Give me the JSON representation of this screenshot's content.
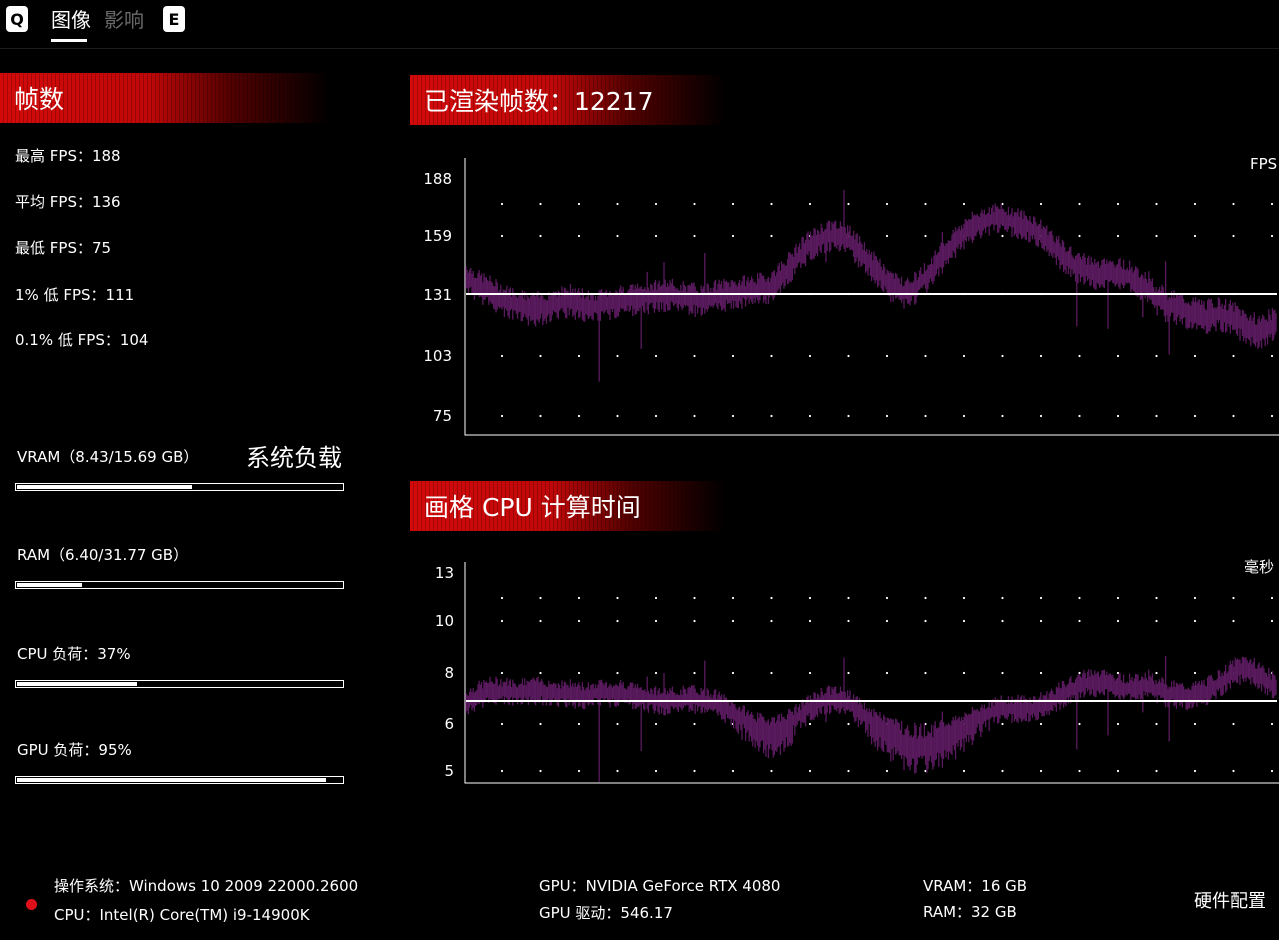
{
  "tabs": {
    "left_key": "Q",
    "right_key": "E",
    "items": [
      {
        "label": "图像",
        "active": true
      },
      {
        "label": "影响",
        "active": false
      }
    ]
  },
  "frames": {
    "title": "帧数",
    "stats": [
      {
        "label": "最高 FPS：",
        "value": "188"
      },
      {
        "label": "平均 FPS：",
        "value": "136"
      },
      {
        "label": "最低 FPS：",
        "value": "75"
      },
      {
        "label": "1% 低 FPS：",
        "value": "111"
      },
      {
        "label": "0.1% 低 FPS：",
        "value": "104"
      }
    ]
  },
  "system_load": {
    "title": "系统负载",
    "meters": [
      {
        "label": "VRAM（8.43/15.69 GB）",
        "fraction": 0.537
      },
      {
        "label": "RAM（6.40/31.77 GB）",
        "fraction": 0.201
      },
      {
        "label": "CPU 负荷：37%",
        "fraction": 0.37
      },
      {
        "label": "GPU 负荷：95%",
        "fraction": 0.95
      }
    ]
  },
  "fps_chart": {
    "title": "已渲染帧数：12217",
    "unit": "FPS",
    "y_ticks": [
      "188",
      "159",
      "131",
      "103",
      "75"
    ]
  },
  "cpu_chart": {
    "title": "画格 CPU 计算时间",
    "unit": "毫秒",
    "y_ticks": [
      "13",
      "10",
      "8",
      "6",
      "5"
    ]
  },
  "chart_data": [
    {
      "type": "area",
      "title": "已渲染帧数：12217",
      "ylabel": "FPS",
      "ylim": [
        75,
        188
      ],
      "y_ticks": [
        188,
        159,
        131,
        103,
        75
      ],
      "average_line": 131,
      "series": [
        {
          "color": "#5a1a5e",
          "values": [
            140,
            135,
            132,
            128,
            126,
            124,
            125,
            127,
            128,
            126,
            125,
            127,
            128,
            129,
            130,
            131,
            130,
            129,
            128,
            130,
            131,
            132,
            133,
            134,
            140,
            147,
            154,
            158,
            160,
            157,
            150,
            143,
            136,
            132,
            134,
            140,
            148,
            156,
            162,
            166,
            168,
            167,
            165,
            162,
            157,
            150,
            145,
            142,
            140,
            141,
            140,
            136,
            130,
            126,
            124,
            122,
            121,
            122,
            120,
            116,
            114,
            117
          ]
        }
      ],
      "colors": {
        "series": "#5a1a5e",
        "average": "#ffffff",
        "grid_dots": "#ffffff"
      }
    },
    {
      "type": "area",
      "title": "画格 CPU 计算时间",
      "ylabel": "毫秒",
      "ylim": [
        5,
        13
      ],
      "y_ticks": [
        13,
        10,
        8,
        6,
        5
      ],
      "average_line": 6.9,
      "series": [
        {
          "color": "#5a1a5e",
          "values": [
            6.8,
            7.1,
            7.3,
            7.3,
            7.2,
            7.3,
            7.3,
            7.2,
            7.2,
            7.1,
            7.2,
            7.2,
            7.2,
            7.1,
            7.0,
            6.9,
            6.9,
            7.0,
            6.9,
            6.8,
            6.5,
            6.2,
            5.9,
            5.8,
            5.9,
            6.2,
            6.6,
            6.9,
            7.0,
            6.8,
            6.4,
            6.0,
            5.8,
            5.6,
            5.5,
            5.5,
            5.6,
            5.8,
            6.0,
            6.3,
            6.5,
            6.6,
            6.6,
            6.6,
            6.8,
            7.1,
            7.4,
            7.6,
            7.6,
            7.5,
            7.4,
            7.5,
            7.4,
            7.2,
            7.1,
            7.1,
            7.3,
            7.6,
            8.0,
            8.2,
            7.9,
            7.5
          ]
        }
      ],
      "colors": {
        "series": "#5a1a5e",
        "average": "#ffffff",
        "grid_dots": "#ffffff"
      }
    }
  ],
  "hardware": {
    "title": "硬件配置",
    "os": "操作系统：Windows 10 2009 22000.2600",
    "cpu": "CPU：Intel(R) Core(TM) i9-14900K",
    "gpu": "GPU：NVIDIA GeForce RTX 4080",
    "gpu_driver": "GPU 驱动：546.17",
    "vram": "VRAM：16 GB",
    "ram": "RAM：32 GB"
  }
}
